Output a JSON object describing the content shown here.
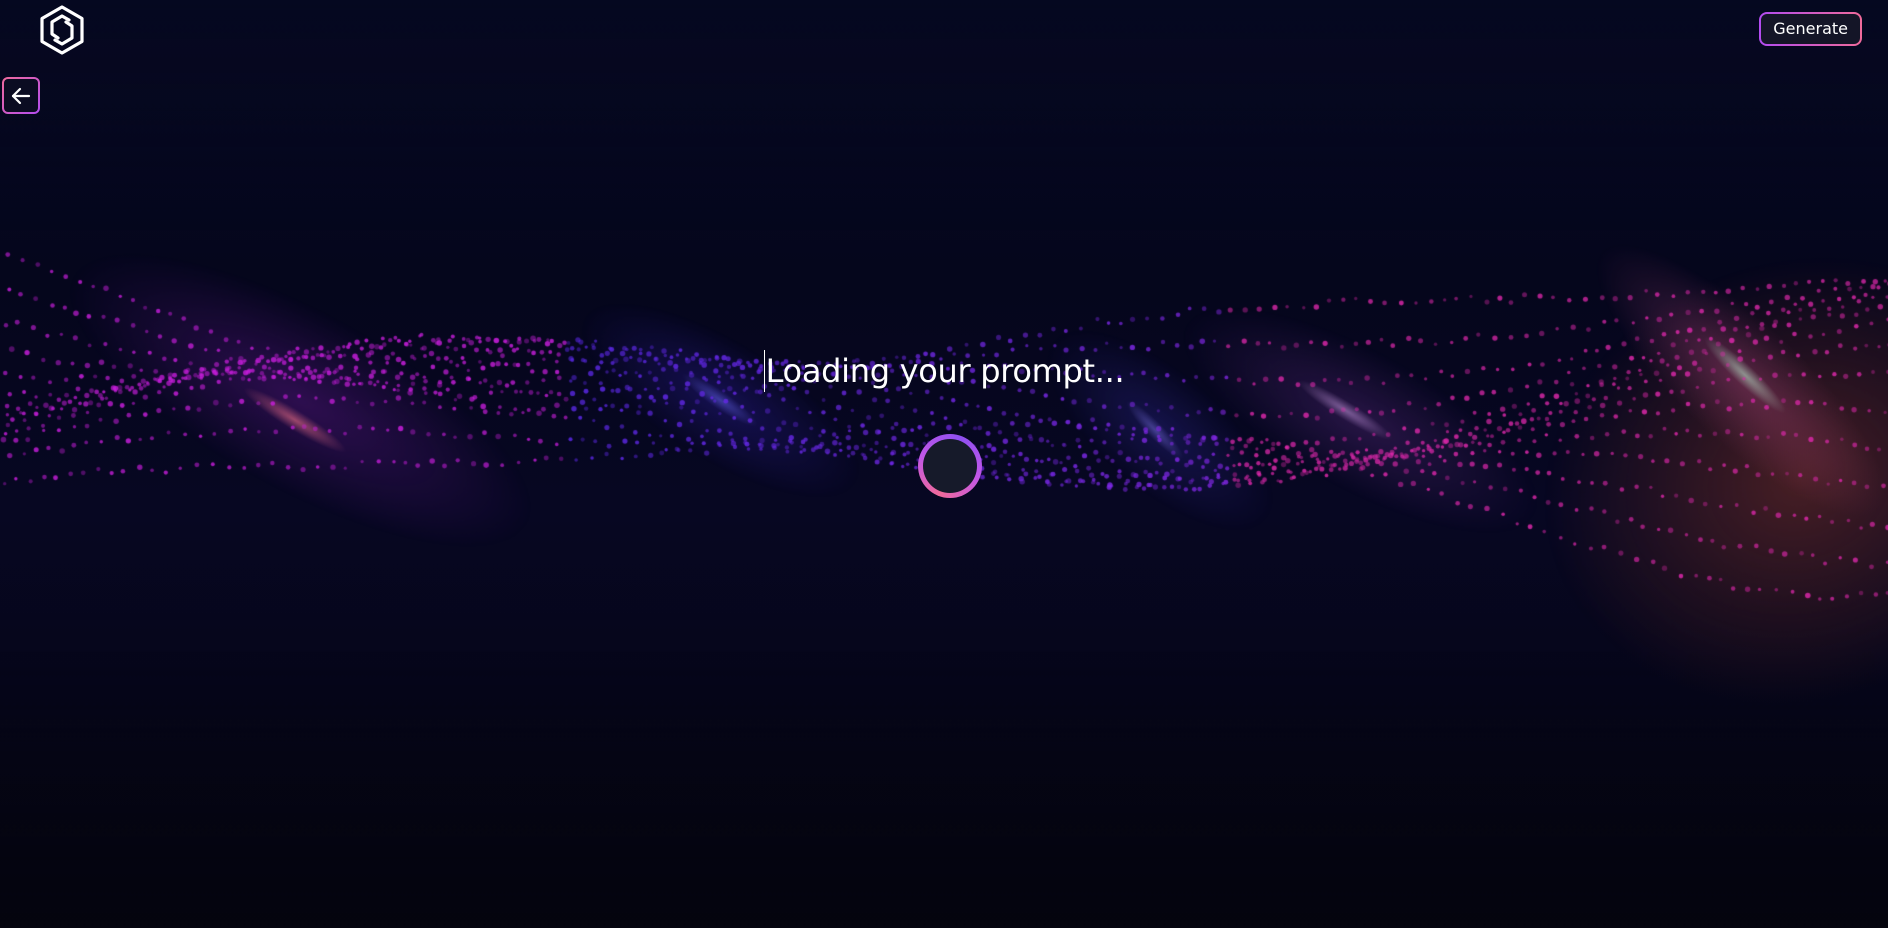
{
  "header": {
    "logo_icon": "hexagon-logo-icon",
    "generate_label": "Generate"
  },
  "navigation": {
    "back_icon": "arrow-left-icon"
  },
  "main": {
    "loading_text": "Loading your prompt...",
    "spinner_icon": "loading-spinner-icon"
  },
  "colors": {
    "background": "#05061a",
    "accent_pink": "#f06a9b",
    "accent_purple": "#b24cf0",
    "text": "#ffffff"
  }
}
